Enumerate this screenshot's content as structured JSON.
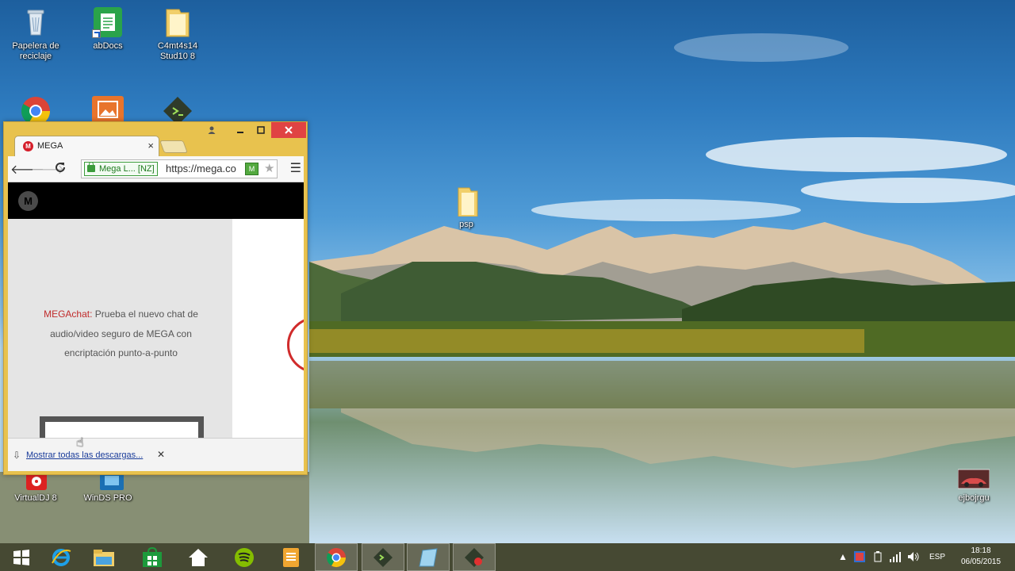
{
  "desktop": {
    "icons": [
      {
        "label": "Papelera de reciclaje",
        "icon": "recycle-bin-icon"
      },
      {
        "label": "abDocs",
        "icon": "document-icon"
      },
      {
        "label": "C4mt4s14 Stud10 8",
        "icon": "folder-icon"
      },
      {
        "label": "",
        "icon": "chrome-icon"
      },
      {
        "label": "",
        "icon": "photo-app-icon"
      },
      {
        "label": "",
        "icon": "console-app-icon"
      },
      {
        "label": "psp",
        "icon": "folder-icon"
      },
      {
        "label": "VirtualDJ 8",
        "icon": "virtualdj-icon"
      },
      {
        "label": "WinDS PRO",
        "icon": "winds-pro-icon"
      },
      {
        "label": "ejbojrgu",
        "icon": "car-image-icon"
      }
    ]
  },
  "browser": {
    "tab_title": "MEGA",
    "tab_favicon": "M",
    "ev_label": "Mega L... [NZ]",
    "url": "https://mega.co",
    "ext_label": "M",
    "page": {
      "logo": "M",
      "chat_highlight": "MEGAchat:",
      "chat_line1": "Prueba el nuevo chat de",
      "chat_line2": "audio/video seguro de MEGA con",
      "chat_line3": "encriptación punto-a-punto"
    },
    "download_bar": {
      "show_all": "Mostrar todas las descargas..."
    }
  },
  "taskbar": {
    "items": [
      {
        "icon": "start-windows-icon"
      },
      {
        "icon": "internet-explorer-icon"
      },
      {
        "icon": "file-explorer-icon"
      },
      {
        "icon": "store-icon"
      },
      {
        "icon": "home-icon"
      },
      {
        "icon": "spotify-icon"
      },
      {
        "icon": "notes-app-icon"
      },
      {
        "icon": "chrome-icon",
        "active": true
      },
      {
        "icon": "terminal-icon"
      },
      {
        "icon": "notepad-icon"
      },
      {
        "icon": "recorder-icon"
      }
    ],
    "language": "ESP",
    "time": "18:18",
    "date": "06/05/2015"
  },
  "colors": {
    "window_frame": "#e8c24e",
    "mega_red": "#d51e2a",
    "taskbar": "#363a22"
  }
}
